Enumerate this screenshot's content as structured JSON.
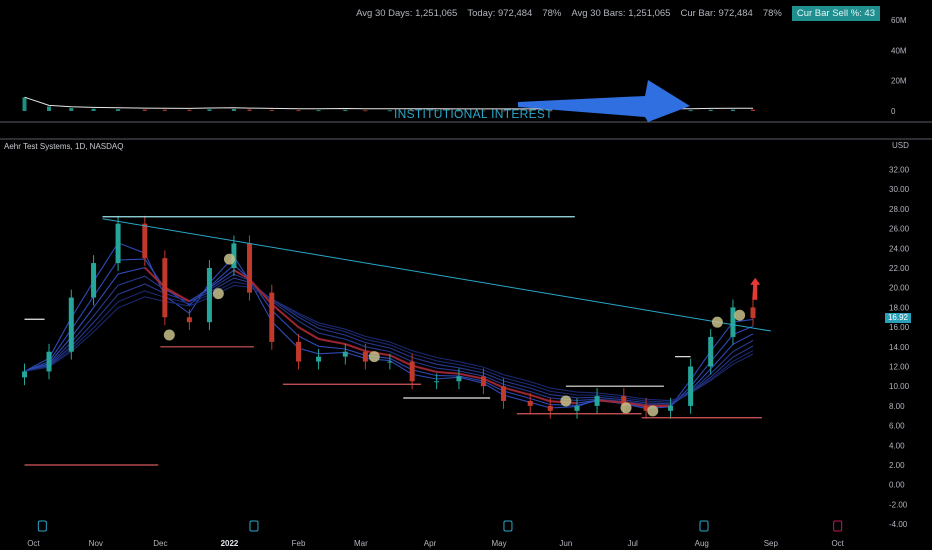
{
  "header": {
    "avg30days_label": "Avg 30 Days: 1,251,065",
    "today_label": "Today: 972,484",
    "today_pct": "78%",
    "avg30bars_label": "Avg 30 Bars: 1,251,065",
    "curbar_label": "Cur Bar: 972,484",
    "curbar_pct": "78%",
    "sell_badge": "Cur Bar Sell %: 43"
  },
  "volume_pane": {
    "axis_labels": [
      "60M",
      "40M",
      "20M",
      "0"
    ],
    "annotation": "INSTITUTIONAL INTEREST",
    "arrow_color": "#2f6fe0"
  },
  "symbol": "Aehr Test Systems, 1D, NASDAQ",
  "currency": "USD",
  "last_price": "16.92",
  "colors": {
    "background": "#000000",
    "teal": "#26a69a",
    "red": "#c0392b",
    "trendline": "#2aa7c9",
    "price_badge": "#2a9fb8",
    "badge": "#1f8f8f"
  },
  "chart_data": {
    "type": "candlestick",
    "title": "Aehr Test Systems, 1D, NASDAQ",
    "x_tick_labels": [
      "Oct",
      "Nov",
      "Dec",
      "2022",
      "Feb",
      "Mar",
      "Apr",
      "May",
      "Jun",
      "Jul",
      "Aug",
      "Sep",
      "Oct"
    ],
    "y_tick_labels": [
      "32.00",
      "30.00",
      "28.00",
      "26.00",
      "24.00",
      "22.00",
      "20.00",
      "18.00",
      "16.00",
      "14.00",
      "12.00",
      "10.00",
      "8.00",
      "6.00",
      "4.00",
      "2.00",
      "0.00",
      "-2.00",
      "-4.00"
    ],
    "ylim": [
      -4,
      33
    ],
    "dates": [
      "2021-10-01",
      "2021-10-12",
      "2021-10-22",
      "2021-11-01",
      "2021-11-12",
      "2021-11-24",
      "2021-12-03",
      "2021-12-14",
      "2021-12-23",
      "2022-01-03",
      "2022-01-10",
      "2022-01-20",
      "2022-02-01",
      "2022-02-10",
      "2022-02-22",
      "2022-03-03",
      "2022-03-14",
      "2022-03-24",
      "2022-04-04",
      "2022-04-14",
      "2022-04-25",
      "2022-05-04",
      "2022-05-16",
      "2022-05-25",
      "2022-06-06",
      "2022-06-15",
      "2022-06-27",
      "2022-07-07",
      "2022-07-18",
      "2022-07-27",
      "2022-08-05",
      "2022-08-15",
      "2022-08-24"
    ],
    "close": [
      11.5,
      13.5,
      19.0,
      22.5,
      26.5,
      23.0,
      17.0,
      16.5,
      22.0,
      24.5,
      19.5,
      14.5,
      12.5,
      13.0,
      13.5,
      12.5,
      12.5,
      10.5,
      10.5,
      11.0,
      10.0,
      8.5,
      8.0,
      7.5,
      8.0,
      9.0,
      8.0,
      7.5,
      8.0,
      12.0,
      15.0,
      18.0,
      16.92
    ],
    "volume_millions": [
      9,
      3,
      2,
      1.5,
      1.2,
      1.0,
      0.9,
      0.8,
      1.1,
      1.3,
      1.0,
      0.8,
      0.6,
      0.6,
      0.7,
      0.5,
      0.5,
      0.5,
      0.5,
      0.4,
      0.4,
      0.4,
      0.4,
      0.4,
      0.4,
      0.4,
      0.4,
      0.4,
      0.5,
      0.6,
      0.8,
      0.9,
      0.97
    ],
    "volume_ylim": [
      0,
      65
    ],
    "horizontal_levels": [
      {
        "price": 27.2,
        "from": "2021-11-05",
        "to": "2022-06-05"
      },
      {
        "price": 2.0,
        "from": "2021-10-01",
        "to": "2021-11-30"
      },
      {
        "price": 14.0,
        "from": "2021-12-01",
        "to": "2022-01-12"
      },
      {
        "price": 10.2,
        "from": "2022-01-25",
        "to": "2022-03-28"
      },
      {
        "price": 8.8,
        "from": "2022-03-20",
        "to": "2022-04-28"
      },
      {
        "price": 7.2,
        "from": "2022-05-10",
        "to": "2022-07-05"
      },
      {
        "price": 6.8,
        "from": "2022-07-05",
        "to": "2022-08-28"
      },
      {
        "price": 10.0,
        "from": "2022-06-01",
        "to": "2022-07-15"
      },
      {
        "price": 16.8,
        "from": "2021-10-01",
        "to": "2021-10-10"
      },
      {
        "price": 13.0,
        "from": "2022-07-20",
        "to": "2022-07-27"
      }
    ],
    "trendline": {
      "from": {
        "date": "2021-11-05",
        "price": 27.0
      },
      "to": {
        "date": "2022-09-01",
        "price": 15.6
      }
    },
    "markers": [
      {
        "date": "2021-12-05",
        "price": 15.2
      },
      {
        "date": "2021-12-27",
        "price": 19.4
      },
      {
        "date": "2022-01-01",
        "price": 22.9
      },
      {
        "date": "2022-03-07",
        "price": 13.0
      },
      {
        "date": "2022-06-01",
        "price": 8.5
      },
      {
        "date": "2022-06-28",
        "price": 7.8
      },
      {
        "date": "2022-07-10",
        "price": 7.5
      },
      {
        "date": "2022-08-08",
        "price": 16.5
      },
      {
        "date": "2022-08-18",
        "price": 17.2
      }
    ],
    "up_arrow": {
      "date": "2022-08-25",
      "price": 20.0
    },
    "grid": false
  }
}
